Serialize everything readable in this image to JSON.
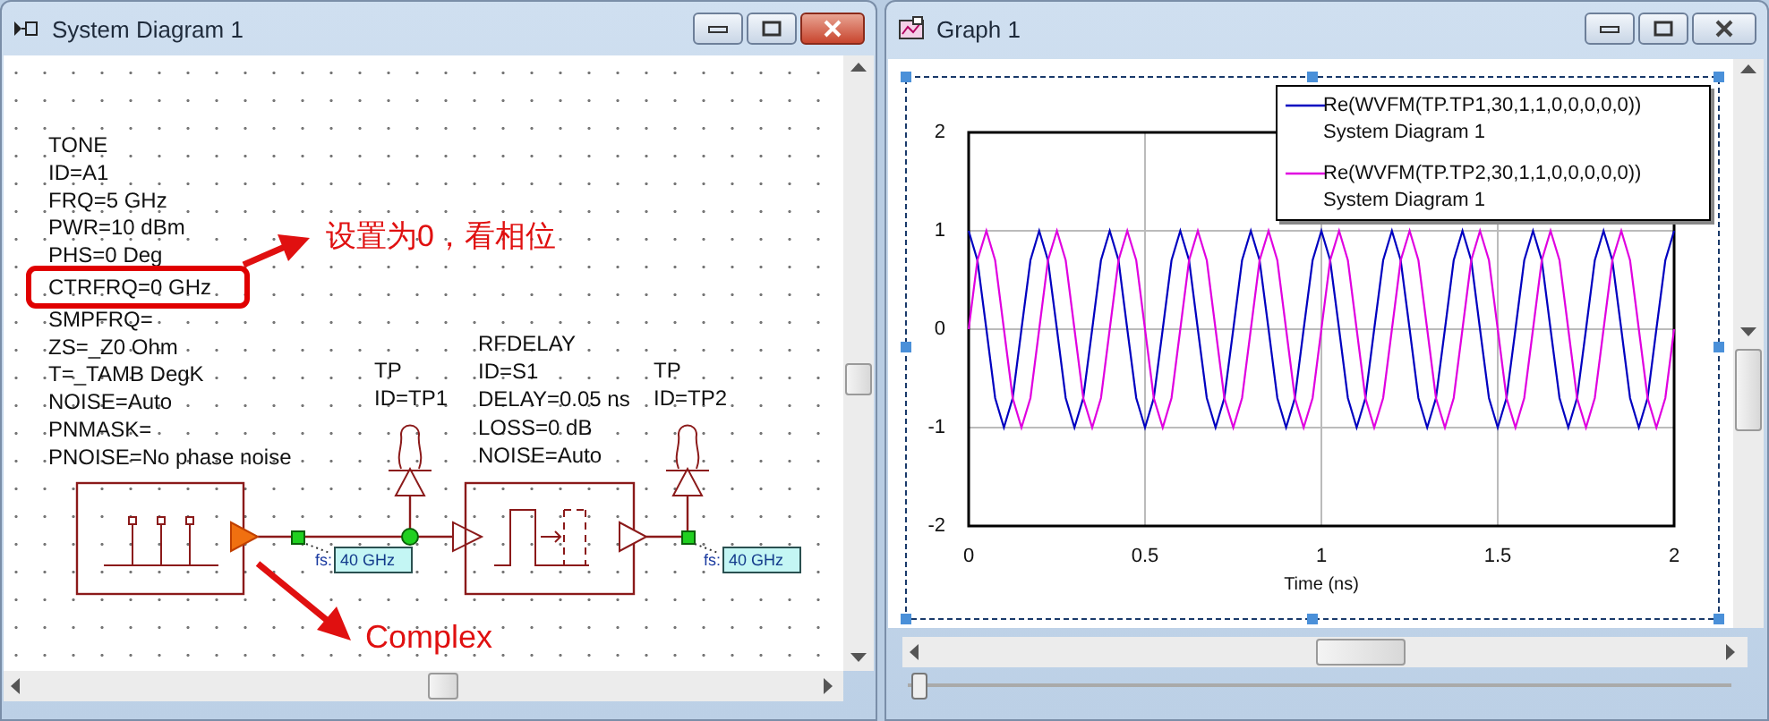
{
  "diagram_window": {
    "title": "System Diagram 1",
    "active": true
  },
  "diagram": {
    "tone_params": [
      {
        "text": "TONE",
        "highlighted": false
      },
      {
        "text": "ID=A1",
        "highlighted": false
      },
      {
        "text": "FRQ=5 GHz",
        "highlighted": false
      },
      {
        "text": "PWR=10 dBm",
        "highlighted": false
      },
      {
        "text": "PHS=0 Deg",
        "highlighted": false
      },
      {
        "text": "CTRFRQ=0 GHz",
        "highlighted": true
      },
      {
        "text": "SMPFRQ=",
        "highlighted": false
      },
      {
        "text": "ZS=_Z0 Ohm",
        "highlighted": false
      },
      {
        "text": "T=_TAMB DegK",
        "highlighted": false
      },
      {
        "text": "NOISE=Auto",
        "highlighted": false
      },
      {
        "text": "PNMASK=",
        "highlighted": false
      },
      {
        "text": "PNOISE=No phase noise",
        "highlighted": false
      }
    ],
    "probe1_params": [
      "TP",
      "ID=TP1"
    ],
    "delay_params": [
      "RFDELAY",
      "ID=S1",
      "DELAY=0.05 ns",
      "LOSS=0 dB",
      "NOISE=Auto"
    ],
    "probe2_params": [
      "TP",
      "ID=TP2"
    ],
    "rate_labels": [
      {
        "prefix": "fs:",
        "value": "40 GHz"
      },
      {
        "prefix": "fs:",
        "value": "40 GHz"
      }
    ],
    "annotations": [
      {
        "kind": "cjk",
        "text": "设置为0，看相位"
      },
      {
        "kind": "mono",
        "text": "Complex"
      }
    ]
  },
  "graph_window": {
    "title": "Graph 1",
    "active": false
  },
  "graph": {
    "legend_sources": [
      "System Diagram 1",
      "System Diagram 1"
    ],
    "chart_data": {
      "type": "line",
      "grid": true,
      "legend": true,
      "xlabel": "Time (ns)",
      "xlim": [
        0,
        2
      ],
      "ylim": [
        -2,
        2
      ],
      "xticks": [
        0,
        0.5,
        1,
        1.5,
        2
      ],
      "yticks": [
        -2,
        -1,
        0,
        1,
        2
      ],
      "x": [
        0,
        0.025,
        0.05,
        0.075,
        0.1,
        0.125,
        0.15,
        0.175,
        0.2,
        0.225,
        0.25,
        0.275,
        0.3,
        0.325,
        0.35,
        0.375,
        0.4,
        0.425,
        0.45,
        0.475,
        0.5,
        0.525,
        0.55,
        0.575,
        0.6,
        0.625,
        0.65,
        0.675,
        0.7,
        0.725,
        0.75,
        0.775,
        0.8,
        0.825,
        0.85,
        0.875,
        0.9,
        0.925,
        0.95,
        0.975,
        1,
        1.025,
        1.05,
        1.075,
        1.1,
        1.125,
        1.15,
        1.175,
        1.2,
        1.225,
        1.25,
        1.275,
        1.3,
        1.325,
        1.35,
        1.375,
        1.4,
        1.425,
        1.45,
        1.475,
        1.5,
        1.525,
        1.55,
        1.575,
        1.6,
        1.625,
        1.65,
        1.675,
        1.7,
        1.725,
        1.75,
        1.775,
        1.8,
        1.825,
        1.85,
        1.875,
        1.9,
        1.925,
        1.95,
        1.975,
        2
      ],
      "series": [
        {
          "name": "Re(WVFM(TP.TP1,30,1,1,0,0,0,0,0))",
          "color": "#0000c0",
          "values": [
            1,
            0.7,
            0,
            -0.7,
            -1,
            -0.7,
            0,
            0.7,
            1,
            0.7,
            0,
            -0.7,
            -1,
            -0.7,
            0,
            0.7,
            1,
            0.7,
            0,
            -0.7,
            -1,
            -0.7,
            0,
            0.7,
            1,
            0.7,
            0,
            -0.7,
            -1,
            -0.7,
            0,
            0.7,
            1,
            0.7,
            0,
            -0.7,
            -1,
            -0.7,
            0,
            0.7,
            1,
            0.7,
            0,
            -0.7,
            -1,
            -0.7,
            0,
            0.7,
            1,
            0.7,
            0,
            -0.7,
            -1,
            -0.7,
            0,
            0.7,
            1,
            0.7,
            0,
            -0.7,
            -1,
            -0.7,
            0,
            0.7,
            1,
            0.7,
            0,
            -0.7,
            -1,
            -0.7,
            0,
            0.7,
            1,
            0.7,
            0,
            -0.7,
            -1,
            -0.7,
            0,
            0.7,
            1
          ]
        },
        {
          "name": "Re(WVFM(TP.TP2,30,1,1,0,0,0,0,0))",
          "color": "#e000e0",
          "values": [
            0,
            0.7,
            1,
            0.7,
            0,
            -0.7,
            -1,
            -0.7,
            0,
            0.7,
            1,
            0.7,
            0,
            -0.7,
            -1,
            -0.7,
            0,
            0.7,
            1,
            0.7,
            0,
            -0.7,
            -1,
            -0.7,
            0,
            0.7,
            1,
            0.7,
            0,
            -0.7,
            -1,
            -0.7,
            0,
            0.7,
            1,
            0.7,
            0,
            -0.7,
            -1,
            -0.7,
            0,
            0.7,
            1,
            0.7,
            0,
            -0.7,
            -1,
            -0.7,
            0,
            0.7,
            1,
            0.7,
            0,
            -0.7,
            -1,
            -0.7,
            0,
            0.7,
            1,
            0.7,
            0,
            -0.7,
            -1,
            -0.7,
            0,
            0.7,
            1,
            0.7,
            0,
            -0.7,
            -1,
            -0.7,
            0,
            0.7,
            1,
            0.7,
            0,
            -0.7,
            -1,
            -0.7,
            0
          ]
        }
      ]
    }
  }
}
